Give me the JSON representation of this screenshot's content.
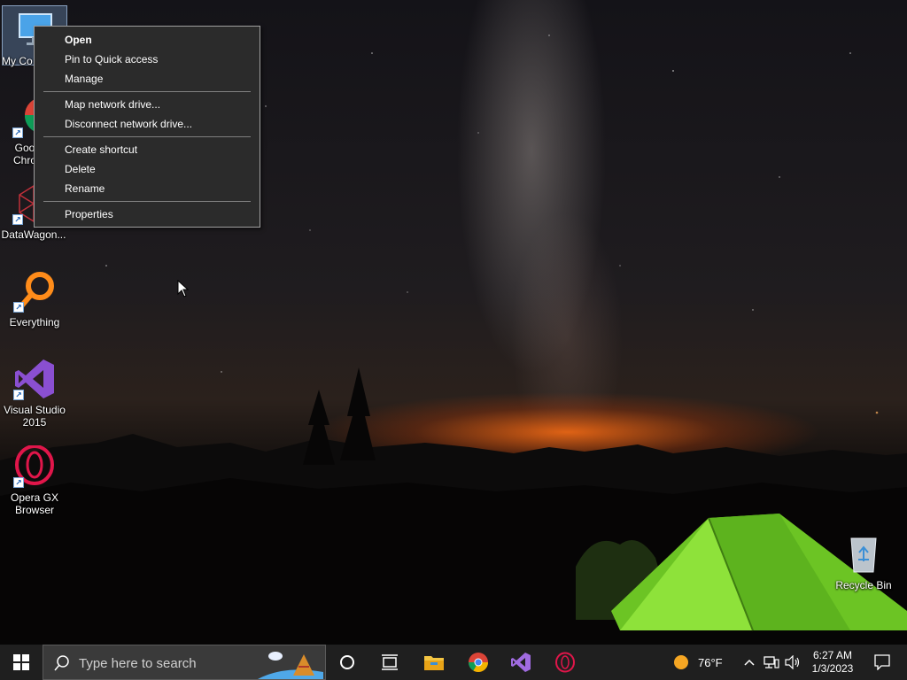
{
  "desktop": {
    "icons": [
      {
        "label": "My Co",
        "icon": "this-pc-icon"
      },
      {
        "label": "Goo\nChro",
        "icon": "chrome-icon"
      },
      {
        "label": "DataWagon...",
        "icon": "datawagon-icon"
      },
      {
        "label": "Everything",
        "icon": "everything-icon"
      },
      {
        "label": "Visual Studio\n2015",
        "icon": "visual-studio-icon"
      },
      {
        "label": "Opera GX\nBrowser",
        "icon": "opera-gx-icon"
      },
      {
        "label": "Recycle Bin",
        "icon": "recycle-bin-icon"
      }
    ]
  },
  "context_menu": {
    "items": [
      {
        "label": "Open",
        "bold": true
      },
      {
        "label": "Pin to Quick access"
      },
      {
        "label": "Manage"
      },
      {
        "label": "Map network drive..."
      },
      {
        "label": "Disconnect network drive..."
      },
      {
        "label": "Create shortcut"
      },
      {
        "label": "Delete"
      },
      {
        "label": "Rename"
      },
      {
        "label": "Properties"
      }
    ]
  },
  "taskbar": {
    "search_placeholder": "Type here to search",
    "weather": {
      "temp": "76°F",
      "icon": "sun-icon"
    },
    "clock": {
      "time": "6:27 AM",
      "date": "1/3/2023"
    },
    "apps": [
      "cortana-icon",
      "task-view-icon",
      "file-explorer-icon",
      "chrome-icon",
      "visual-studio-icon",
      "opera-gx-icon"
    ]
  },
  "colors": {
    "taskbar": "#1f1f1f",
    "menu_bg": "#2b2b2b",
    "tent": "#7ddc2a",
    "horizon": "#ff6a14"
  }
}
